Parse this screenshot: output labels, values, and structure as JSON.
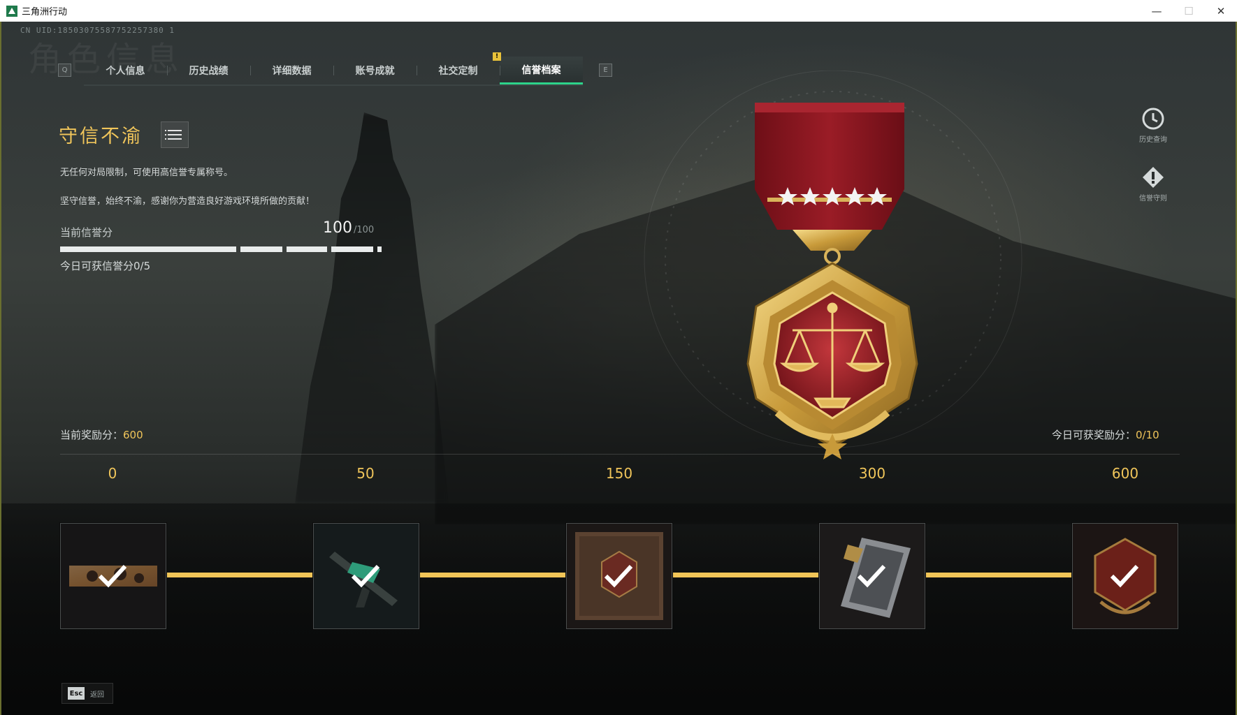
{
  "window": {
    "title": "三角洲行动",
    "min_glyph": "—",
    "max_glyph": "☐",
    "close_glyph": "✕"
  },
  "header": {
    "uid": "CN UID:18503075587752257380 1",
    "ghost_title": "角色信息",
    "left_key": "Q",
    "right_key": "E",
    "alert_glyph": "!"
  },
  "tabs": [
    {
      "label": "个人信息",
      "active": false
    },
    {
      "label": "历史战绩",
      "active": false
    },
    {
      "label": "详细数据",
      "active": false
    },
    {
      "label": "账号成就",
      "active": false
    },
    {
      "label": "社交定制",
      "active": false
    },
    {
      "label": "信誉档案",
      "active": true
    }
  ],
  "profile": {
    "rank_title": "守信不渝",
    "desc_1": "无任何对局限制，可使用高信誉专属称号。",
    "desc_2": "坚守信誉，始终不渝，感谢你为营造良好游戏环境所做的贡献！",
    "credit_label": "当前信誉分",
    "credit_value": "100",
    "credit_max": "/100",
    "daily_credit": "今日可获信誉分0/5"
  },
  "side_buttons": {
    "history_label": "历史查询",
    "rules_label": "信誉守则"
  },
  "rewards": {
    "current_label": "当前奖励分：",
    "current_value": "600",
    "daily_label": "今日可获奖励分：",
    "daily_value": "0/10",
    "tiers": [
      {
        "score": "0",
        "claimed": true
      },
      {
        "score": "50",
        "claimed": true
      },
      {
        "score": "150",
        "claimed": true
      },
      {
        "score": "300",
        "claimed": true
      },
      {
        "score": "600",
        "claimed": true
      }
    ]
  },
  "footer": {
    "esc_key": "Esc",
    "esc_label": "返回"
  },
  "colors": {
    "accent_gold": "#f0c55a",
    "active_tab": "#2dd38a",
    "medal_red": "#8e1620"
  }
}
